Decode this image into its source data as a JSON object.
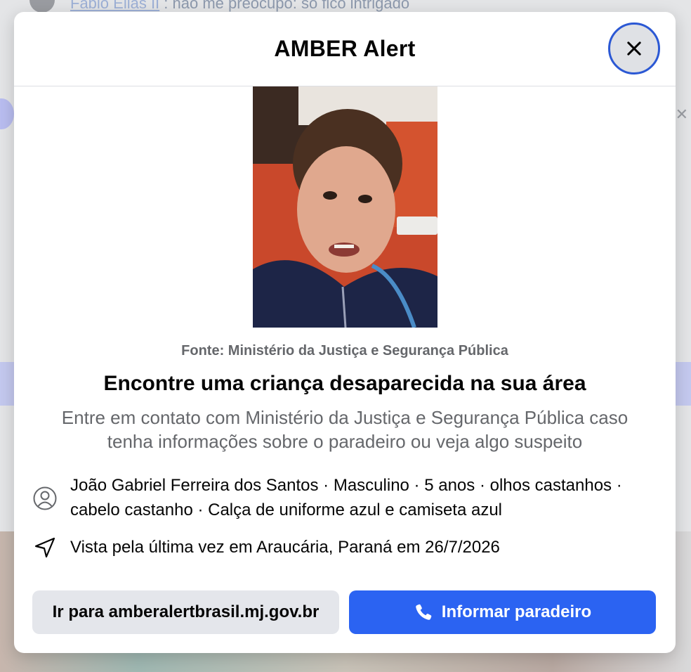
{
  "background": {
    "comment_author": "Fabio Elias II",
    "comment_text": ": não me preocupo: só fico intrigado"
  },
  "modal": {
    "title": "AMBER Alert",
    "close_icon": "close-icon",
    "source": "Fonte: Ministério da Justiça e Segurança Pública",
    "headline": "Encontre uma criança desaparecida na sua área",
    "subline": "Entre em contato com Ministério da Justiça e Segurança Pública caso tenha informações sobre o paradeiro ou veja algo suspeito",
    "person": {
      "icon": "person-icon",
      "description": "João Gabriel Ferreira dos Santos · Masculino · 5 anos · olhos castanhos · cabelo castanho · Calça de uniforme azul e camiseta azul"
    },
    "location": {
      "icon": "location-arrow-icon",
      "description": "Vista pela última vez em Araucária, Paraná em 26/7/2026"
    },
    "actions": {
      "secondary_label": "Ir para amberalertbrasil.mj.gov.br",
      "primary_label": "Informar paradeiro",
      "primary_icon": "phone-icon"
    }
  },
  "colors": {
    "primary_button": "#2b63f2",
    "secondary_button": "#e4e6eb",
    "close_focus_ring": "#2b58d4",
    "muted_text": "#65676b"
  }
}
